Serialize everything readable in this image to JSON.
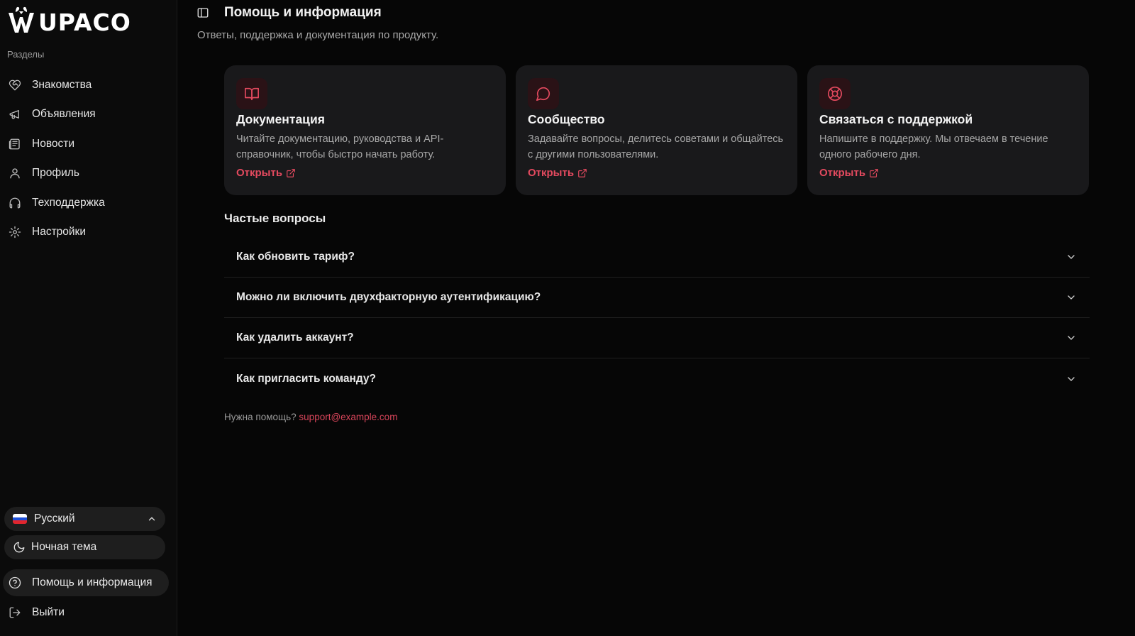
{
  "app": {
    "logo_text": "UPACO"
  },
  "sidebar": {
    "section_label": "Разделы",
    "items": [
      {
        "label": "Знакомства",
        "icon": "heart-handshake-icon"
      },
      {
        "label": "Объявления",
        "icon": "megaphone-icon"
      },
      {
        "label": "Новости",
        "icon": "newspaper-icon"
      },
      {
        "label": "Профиль",
        "icon": "user-icon"
      },
      {
        "label": "Техподдержка",
        "icon": "headphones-icon"
      },
      {
        "label": "Настройки",
        "icon": "gear-icon"
      }
    ],
    "language": {
      "label": "Русский",
      "icon": "russian-flag-icon"
    },
    "theme": {
      "label": "Ночная тема",
      "icon": "moon-icon"
    },
    "help": {
      "label": "Помощь и информация",
      "icon": "help-circle-icon"
    },
    "logout": {
      "label": "Выйти",
      "icon": "logout-icon"
    }
  },
  "header": {
    "title": "Помощь и информация",
    "subtitle": "Ответы, поддержка и документация по продукту."
  },
  "cards": [
    {
      "title": "Документация",
      "description": "Читайте документацию, руководства и API-справочник, чтобы быстро начать работу.",
      "link_label": "Открыть",
      "icon": "book-open-icon"
    },
    {
      "title": "Сообщество",
      "description": "Задавайте вопросы, делитесь советами и общайтесь с другими пользователями.",
      "link_label": "Открыть",
      "icon": "message-circle-icon"
    },
    {
      "title": "Связаться с поддержкой",
      "description": "Напишите в поддержку. Мы отвечаем в течение одного рабочего дня.",
      "link_label": "Открыть",
      "icon": "life-buoy-icon"
    }
  ],
  "faq": {
    "title": "Частые вопросы",
    "items": [
      {
        "question": "Как обновить тариф?"
      },
      {
        "question": "Можно ли включить двухфакторную аутентификацию?"
      },
      {
        "question": "Как удалить аккаунт?"
      },
      {
        "question": "Как пригласить команду?"
      }
    ]
  },
  "footer": {
    "need_help": "Нужна помощь?",
    "email": "support@example.com"
  },
  "colors": {
    "accent": "#e44a5f",
    "background": "#060606",
    "card": "#19191b",
    "sidebar": "#0b0b0b"
  }
}
